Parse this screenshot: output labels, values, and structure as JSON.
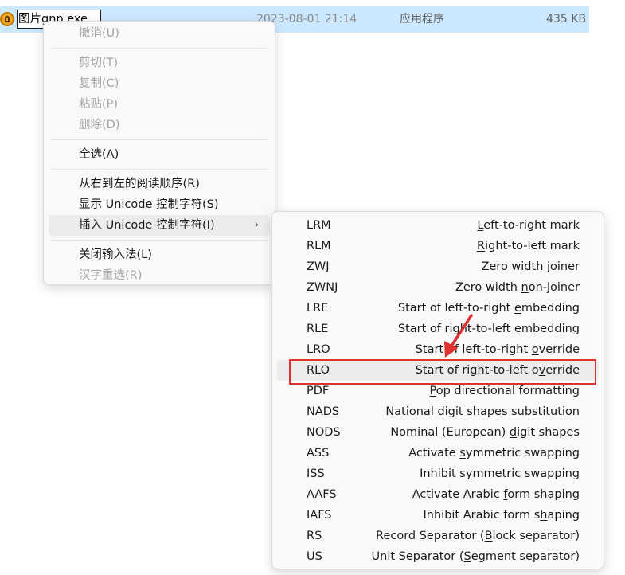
{
  "file_row": {
    "name": "图片gnp.exe",
    "date": "2023-08-01 21:14",
    "type": "应用程序",
    "size": "435 KB",
    "icon": "app-exe-icon"
  },
  "context_menu": {
    "items": [
      {
        "label": "撤消(U)",
        "enabled": false
      },
      {
        "label": "剪切(T)",
        "enabled": false
      },
      {
        "label": "复制(C)",
        "enabled": false
      },
      {
        "label": "粘贴(P)",
        "enabled": false
      },
      {
        "label": "删除(D)",
        "enabled": false
      },
      {
        "label": "全选(A)",
        "enabled": true
      },
      {
        "label": "从右到左的阅读顺序(R)",
        "enabled": true
      },
      {
        "label": "显示 Unicode 控制字符(S)",
        "enabled": true
      },
      {
        "label": "插入 Unicode 控制字符(I)",
        "enabled": true,
        "submenu_arrow": "›"
      },
      {
        "label": "关闭输入法(L)",
        "enabled": true
      },
      {
        "label": "汉字重选(R)",
        "enabled": false
      }
    ]
  },
  "submenu": {
    "items": [
      {
        "code": "LRM",
        "pre": "",
        "u": "L",
        "post": "eft-to-right mark"
      },
      {
        "code": "RLM",
        "pre": "",
        "u": "R",
        "post": "ight-to-left mark"
      },
      {
        "code": "ZWJ",
        "pre": "",
        "u": "Z",
        "post": "ero width joiner"
      },
      {
        "code": "ZWNJ",
        "pre": "Zero width ",
        "u": "n",
        "post": "on-joiner"
      },
      {
        "code": "LRE",
        "pre": "Start of left-to-right ",
        "u": "e",
        "post": "mbedding"
      },
      {
        "code": "RLE",
        "pre": "Start of right-to-left e",
        "u": "m",
        "post": "bedding"
      },
      {
        "code": "LRO",
        "pre": "Start of left-to-right ",
        "u": "o",
        "post": "verride"
      },
      {
        "code": "RLO",
        "pre": "Start of right-to-left o",
        "u": "v",
        "post": "erride"
      },
      {
        "code": "PDF",
        "pre": "",
        "u": "P",
        "post": "op directional formatting"
      },
      {
        "code": "NADS",
        "pre": "N",
        "u": "a",
        "post": "tional digit shapes substitution"
      },
      {
        "code": "NODS",
        "pre": "Nominal (European) ",
        "u": "d",
        "post": "igit shapes"
      },
      {
        "code": "ASS",
        "pre": "Activate ",
        "u": "s",
        "post": "ymmetric swapping"
      },
      {
        "code": "ISS",
        "pre": "Inhibit s",
        "u": "y",
        "post": "mmetric swapping"
      },
      {
        "code": "AAFS",
        "pre": "Activate Arabic ",
        "u": "f",
        "post": "orm shaping"
      },
      {
        "code": "IAFS",
        "pre": "Inhibit Arabic form s",
        "u": "h",
        "post": "aping"
      },
      {
        "code": "RS",
        "pre": "Record Separator (",
        "u": "B",
        "post": "lock separator)"
      },
      {
        "code": "US",
        "pre": "Unit Separator (",
        "u": "S",
        "post": "egment separator)"
      }
    ]
  },
  "annotation": {
    "color": "#e03131"
  }
}
